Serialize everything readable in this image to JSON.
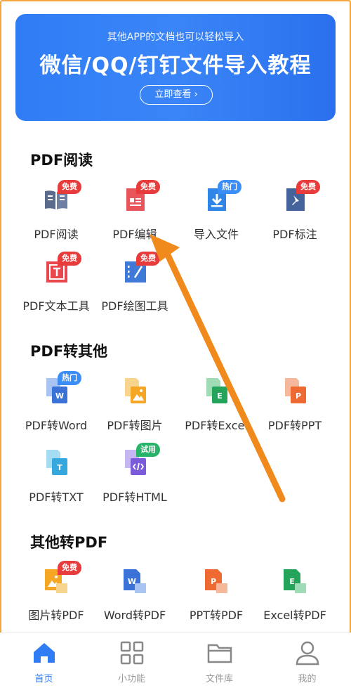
{
  "banner": {
    "subtitle": "其他APP的文档也可以轻松导入",
    "title": "微信/QQ/钉钉文件导入教程",
    "button": "立即查看 ›"
  },
  "sections": {
    "pdf_read": {
      "title": "PDF阅读",
      "items": [
        {
          "label": "PDF阅读",
          "badge": "免费",
          "icon": "book-icon"
        },
        {
          "label": "PDF编辑",
          "badge": "免费",
          "icon": "edit-doc-icon"
        },
        {
          "label": "导入文件",
          "badge": "热门",
          "icon": "import-icon"
        },
        {
          "label": "PDF标注",
          "badge": "免费",
          "icon": "pin-icon"
        },
        {
          "label": "PDF文本工具",
          "badge": "免费",
          "icon": "text-tool-icon"
        },
        {
          "label": "PDF绘图工具",
          "badge": "免费",
          "icon": "draw-tool-icon"
        }
      ]
    },
    "pdf_to_other": {
      "title": "PDF转其他",
      "items": [
        {
          "label": "PDF转Word",
          "badge": "热门",
          "icon": "word-icon"
        },
        {
          "label": "PDF转图片",
          "badge": "",
          "icon": "image-icon"
        },
        {
          "label": "PDF转Excel",
          "badge": "",
          "icon": "excel-icon"
        },
        {
          "label": "PDF转PPT",
          "badge": "",
          "icon": "ppt-icon"
        },
        {
          "label": "PDF转TXT",
          "badge": "",
          "icon": "txt-icon"
        },
        {
          "label": "PDF转HTML",
          "badge": "试用",
          "icon": "html-icon"
        }
      ]
    },
    "other_to_pdf": {
      "title": "其他转PDF",
      "items": [
        {
          "label": "图片转PDF",
          "badge": "免费",
          "icon": "image-icon"
        },
        {
          "label": "Word转PDF",
          "badge": "",
          "icon": "word-icon"
        },
        {
          "label": "PPT转PDF",
          "badge": "",
          "icon": "ppt-icon"
        },
        {
          "label": "Excel转PDF",
          "badge": "",
          "icon": "excel-icon"
        }
      ]
    }
  },
  "nav": [
    {
      "label": "首页",
      "icon": "home-icon",
      "active": true
    },
    {
      "label": "小功能",
      "icon": "grid-icon",
      "active": false
    },
    {
      "label": "文件库",
      "icon": "folder-icon",
      "active": false
    },
    {
      "label": "我的",
      "icon": "user-icon",
      "active": false
    }
  ],
  "colors": {
    "accent": "#2f7cf5",
    "badge_free": "#e83b3b",
    "badge_hot": "#3a8ef5",
    "badge_trial": "#27b36a",
    "annotation_arrow": "#f08a1c"
  }
}
